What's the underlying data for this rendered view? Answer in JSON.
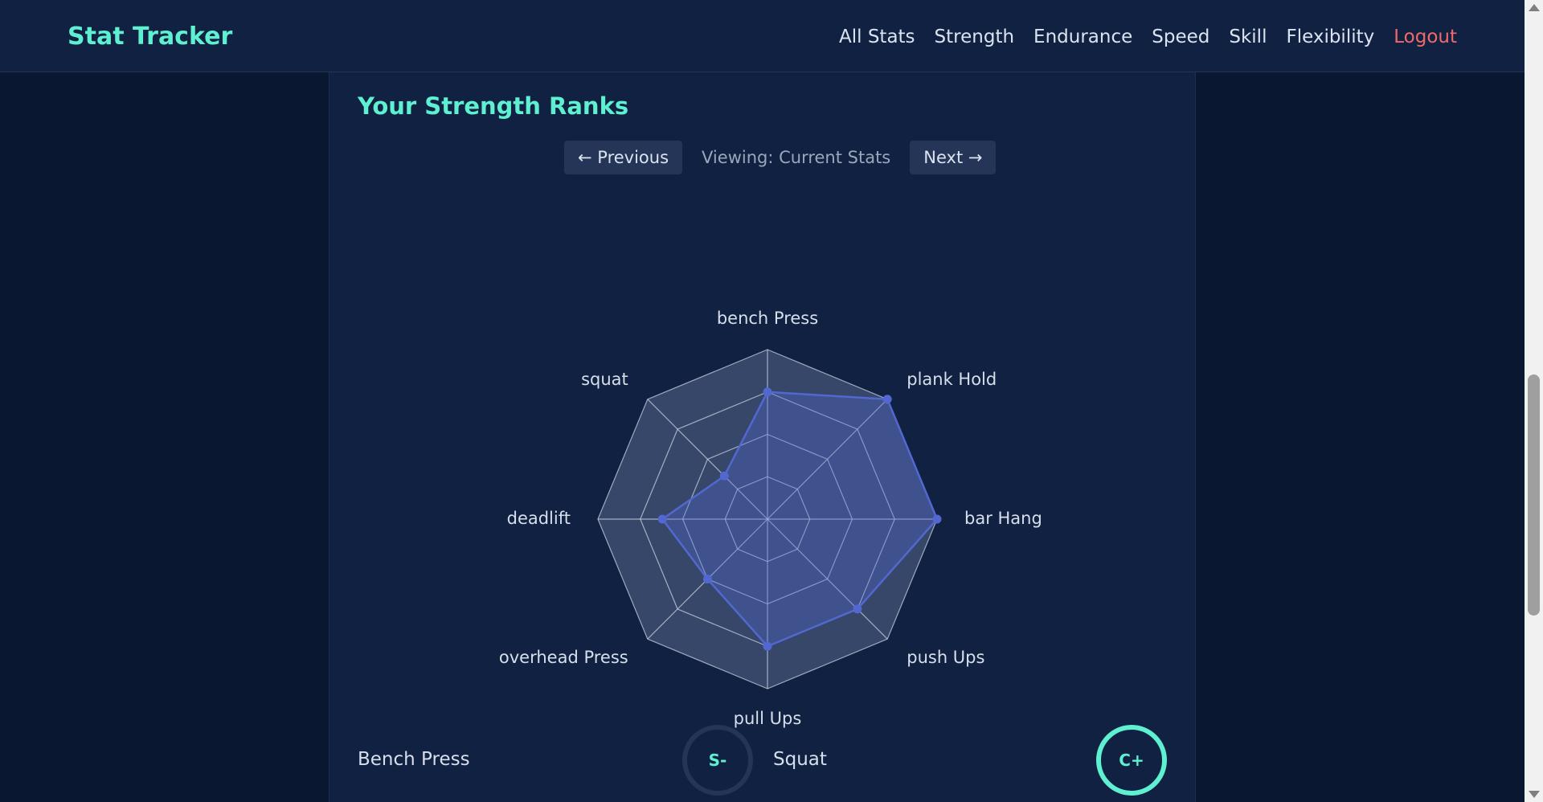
{
  "navbar": {
    "brand": "Stat Tracker",
    "links": [
      "All Stats",
      "Strength",
      "Endurance",
      "Speed",
      "Skill",
      "Flexibility"
    ],
    "logout": "Logout"
  },
  "page": {
    "title": "Your Strength Ranks",
    "prev_label": "← Previous",
    "status": "Viewing: Current Stats",
    "next_label": "Next →"
  },
  "chart_data": {
    "type": "radar",
    "axes": [
      "bench Press",
      "plank Hold",
      "bar Hang",
      "push Ups",
      "pull Ups",
      "overhead Press",
      "deadlift",
      "squat"
    ],
    "values": [
      0.75,
      1.0,
      1.0,
      0.75,
      0.75,
      0.5,
      0.62,
      0.36
    ],
    "max": 1.0,
    "rings": 4,
    "colors": {
      "series": "#5268d0",
      "grid": "#c9d1e0",
      "fill": "#3b4b6e"
    }
  },
  "ranks": [
    {
      "name": "Bench Press",
      "grade": "S-",
      "progress": 0.0
    },
    {
      "name": "Squat",
      "grade": "C+",
      "progress": 1.0
    }
  ],
  "colors": {
    "accent": "#5ef0d0",
    "logout": "#f06a6a",
    "background": "#091730",
    "panel": "#102142"
  }
}
